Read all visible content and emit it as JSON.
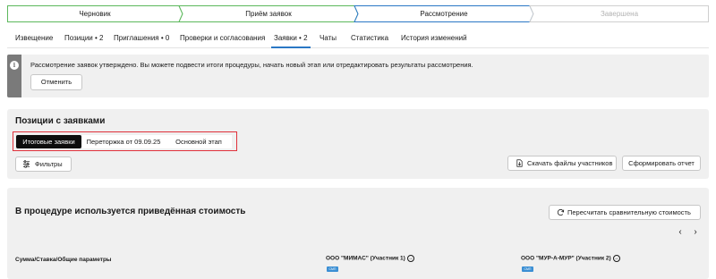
{
  "stepper": {
    "steps": [
      {
        "label": "Черновик",
        "state": "done"
      },
      {
        "label": "Приём заявок",
        "state": "done"
      },
      {
        "label": "Рассмотрение",
        "state": "active"
      },
      {
        "label": "Завершена",
        "state": "future"
      }
    ],
    "colors": {
      "done": "#5cb85c",
      "active": "#2a78c5",
      "future": "#cfcfcf"
    }
  },
  "tabs": [
    {
      "label": "Извещение"
    },
    {
      "label": "Позиции • 2"
    },
    {
      "label": "Приглашения • 0"
    },
    {
      "label": "Проверки и согласования"
    },
    {
      "label": "Заявки • 2",
      "active": true
    },
    {
      "label": "Чаты"
    },
    {
      "label": "Статистика"
    },
    {
      "label": "История изменений"
    }
  ],
  "alert": {
    "icon": "info-icon",
    "text": "Рассмотрение заявок утверждено. Вы можете подвести итоги процедуры, начать новый этап или отредактировать результаты рассмотрения.",
    "cancel_label": "Отменить"
  },
  "positions": {
    "title": "Позиции с заявками",
    "segments": [
      {
        "label": "Итоговые заявки",
        "active": true
      },
      {
        "label": "Переторжка от 09.09.25"
      },
      {
        "label": "Основной этап"
      }
    ],
    "filters_label": "Фильтры",
    "download_label": "Скачать файлы участников",
    "report_label": "Сформировать отчет"
  },
  "cost": {
    "title": "В процедуре используется приведённая стоимость",
    "recalc_label": "Пересчитать сравнительную стоимость",
    "prev_icon": "chevron-left-icon",
    "next_icon": "chevron-right-icon",
    "row_label": "Сумма/Ставка/Общие параметры",
    "participants": [
      {
        "name": "ООО \"МИМАС\" (Участник 1)",
        "badge": "СМП"
      },
      {
        "name": "ООО \"МУР-А-МУР\" (Участник 2)",
        "badge": "СМП"
      }
    ]
  },
  "accent_colors": {
    "primary": "#2a78c5",
    "highlight": "#e0313b",
    "badge": "#3b8fd4"
  }
}
